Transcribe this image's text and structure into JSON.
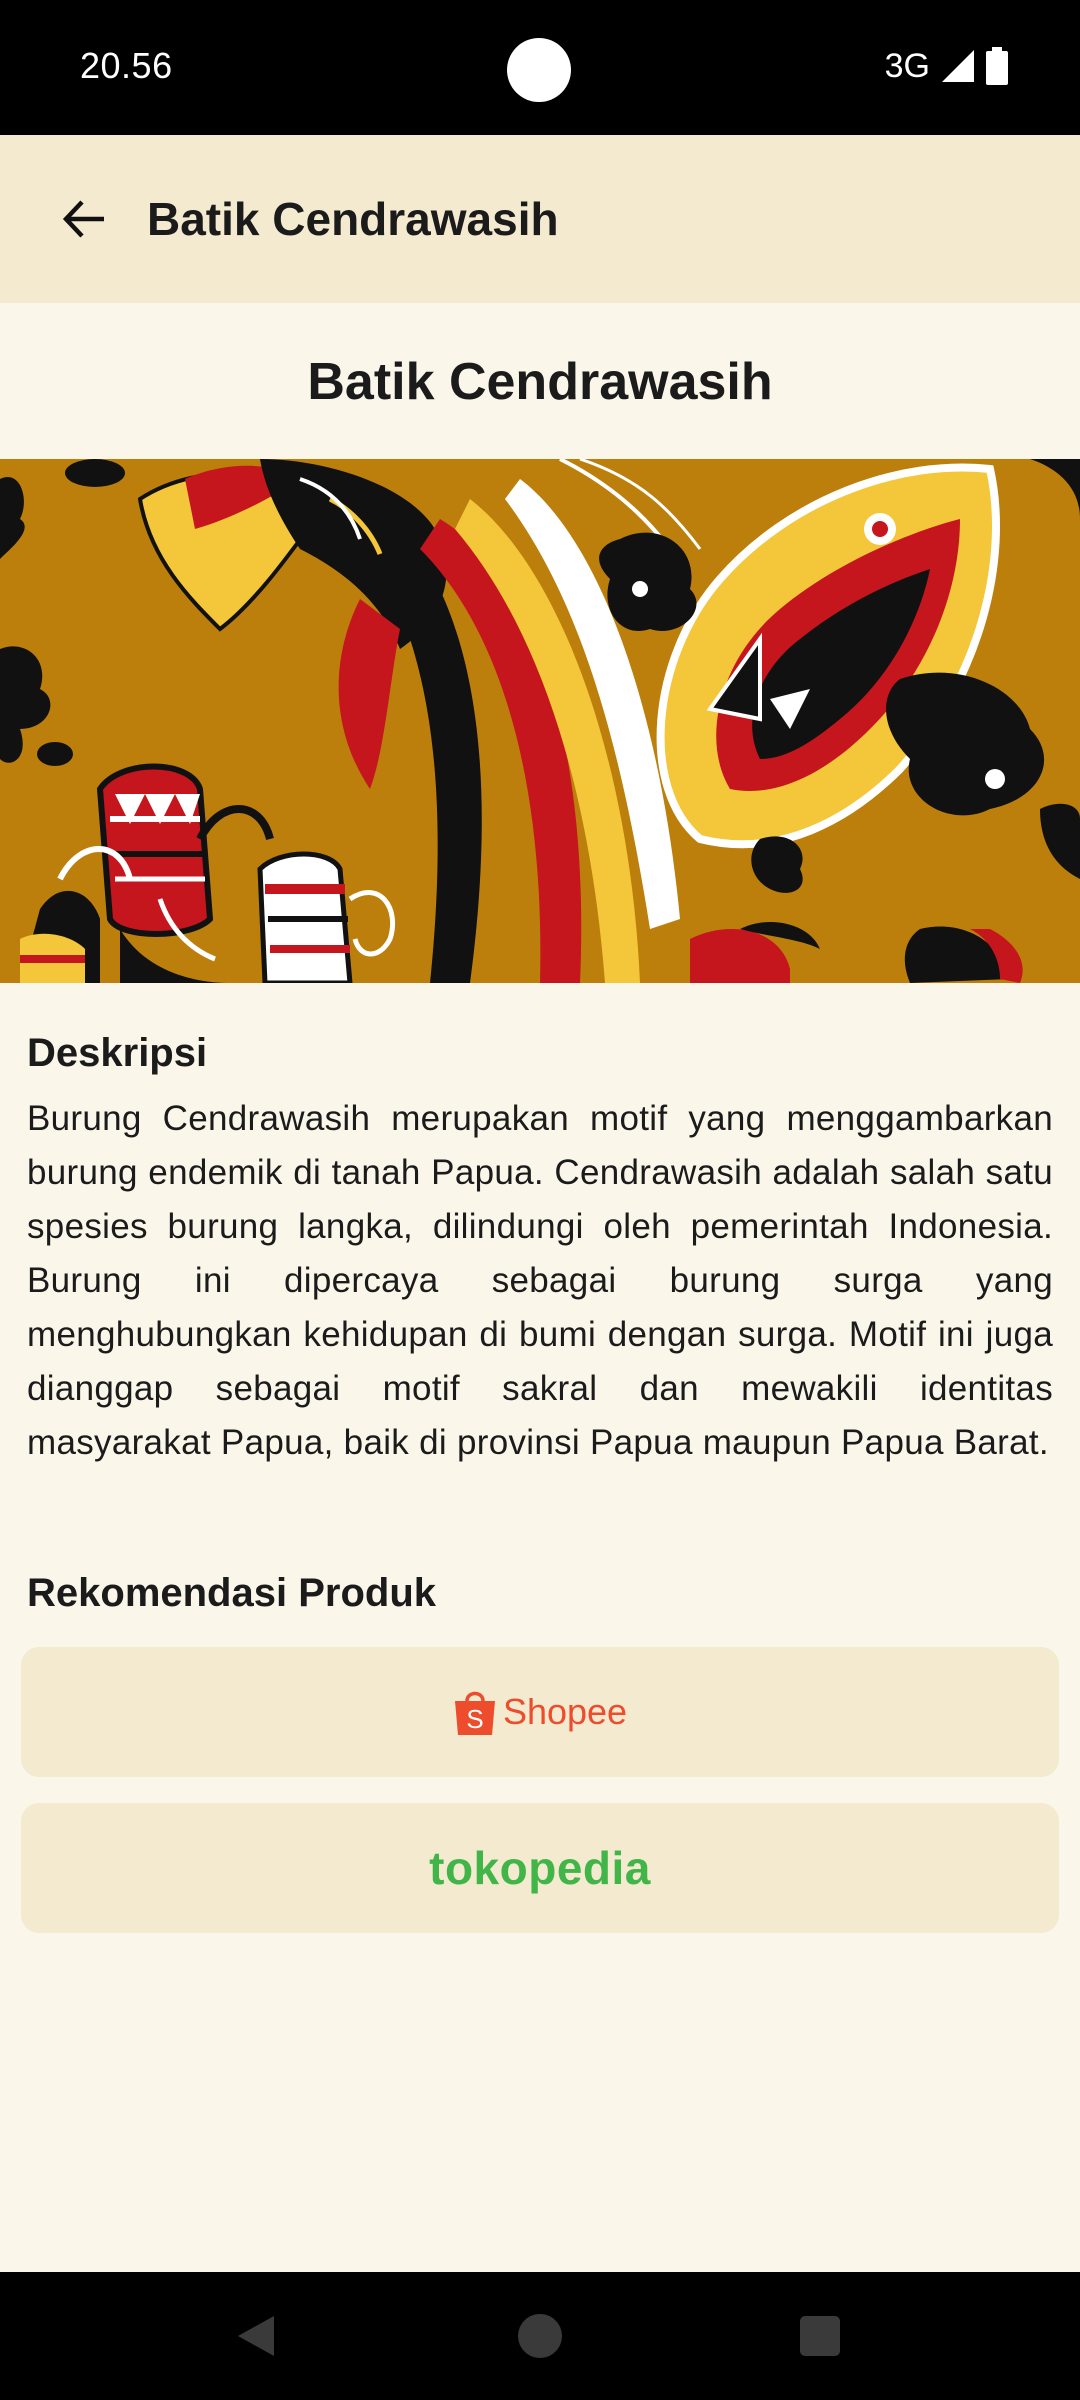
{
  "status_bar": {
    "time": "20.56",
    "network": "3G",
    "icons": [
      "signal-icon",
      "battery-icon"
    ]
  },
  "app_bar": {
    "back_icon": "arrow-left-icon",
    "title": "Batik Cendrawasih"
  },
  "page": {
    "title": "Batik Cendrawasih",
    "image_description": "Batik Cendrawasih pattern image"
  },
  "description": {
    "heading": "Deskripsi",
    "body": "Burung Cendrawasih merupakan motif yang menggambarkan burung endemik di tanah Papua. Cendrawasih adalah salah satu spesies burung langka, dilindungi oleh pemerintah Indonesia. Burung ini dipercaya sebagai burung surga yang menghubungkan kehidupan di bumi dengan surga. Motif ini juga dianggap sebagai motif sakral dan mewakili identitas masyarakat Papua, baik di provinsi Papua maupun Papua Barat."
  },
  "recommendations": {
    "heading": "Rekomendasi Produk",
    "shopee_label": "Shopee",
    "tokopedia_label": "tokopedia"
  },
  "colors": {
    "background": "#faf6ea",
    "app_bar": "#f3ead0",
    "button_bg": "#f3ead0",
    "shopee": "#ee4d2d",
    "tokopedia": "#42b549",
    "batik_base": "#bd7f0c"
  },
  "nav_bar": {
    "icons": [
      "back-triangle-icon",
      "home-circle-icon",
      "recents-square-icon"
    ]
  }
}
